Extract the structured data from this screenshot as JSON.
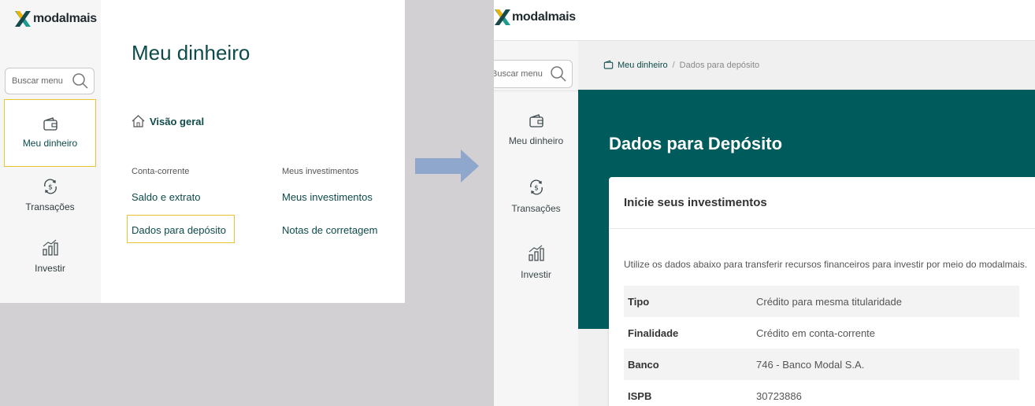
{
  "brand": {
    "name": "modalmais"
  },
  "colors": {
    "primary": "#005c5c",
    "highlight": "#e8c430",
    "arrow": "#8fa7cc"
  },
  "left_screen": {
    "search": {
      "placeholder": "Buscar menu"
    },
    "nav": [
      {
        "label": "Meu dinheiro",
        "icon": "wallet-icon",
        "active": true
      },
      {
        "label": "Transações",
        "icon": "dollar-exchange-icon",
        "active": false
      },
      {
        "label": "Investir",
        "icon": "bar-chart-icon",
        "active": false
      }
    ],
    "main": {
      "title": "Meu dinheiro",
      "overview_label": "Visão geral",
      "checking": {
        "heading": "Conta-corrente",
        "links": [
          "Saldo e extrato",
          "Dados para depósito"
        ]
      },
      "investments": {
        "heading": "Meus investimentos",
        "links": [
          "Meus investimentos",
          "Notas de corretagem"
        ]
      }
    }
  },
  "right_screen": {
    "search": {
      "placeholder": "Buscar menu"
    },
    "nav": [
      {
        "label": "Meu dinheiro",
        "icon": "wallet-icon"
      },
      {
        "label": "Transações",
        "icon": "dollar-exchange-icon"
      },
      {
        "label": "Investir",
        "icon": "bar-chart-icon"
      }
    ],
    "breadcrumb": [
      "Meu dinheiro",
      "Dados para depósito"
    ],
    "hero_title": "Dados para Depósito",
    "card": {
      "title": "Inicie seus investimentos",
      "description": "Utilize os dados abaixo para transferir recursos financeiros para investir por meio do modalmais.",
      "rows": [
        {
          "key": "Tipo",
          "value": "Crédito para mesma titularidade"
        },
        {
          "key": "Finalidade",
          "value": "Crédito em conta-corrente"
        },
        {
          "key": "Banco",
          "value": "746 - Banco Modal S.A."
        },
        {
          "key": "ISPB",
          "value": "30723886"
        }
      ]
    }
  }
}
